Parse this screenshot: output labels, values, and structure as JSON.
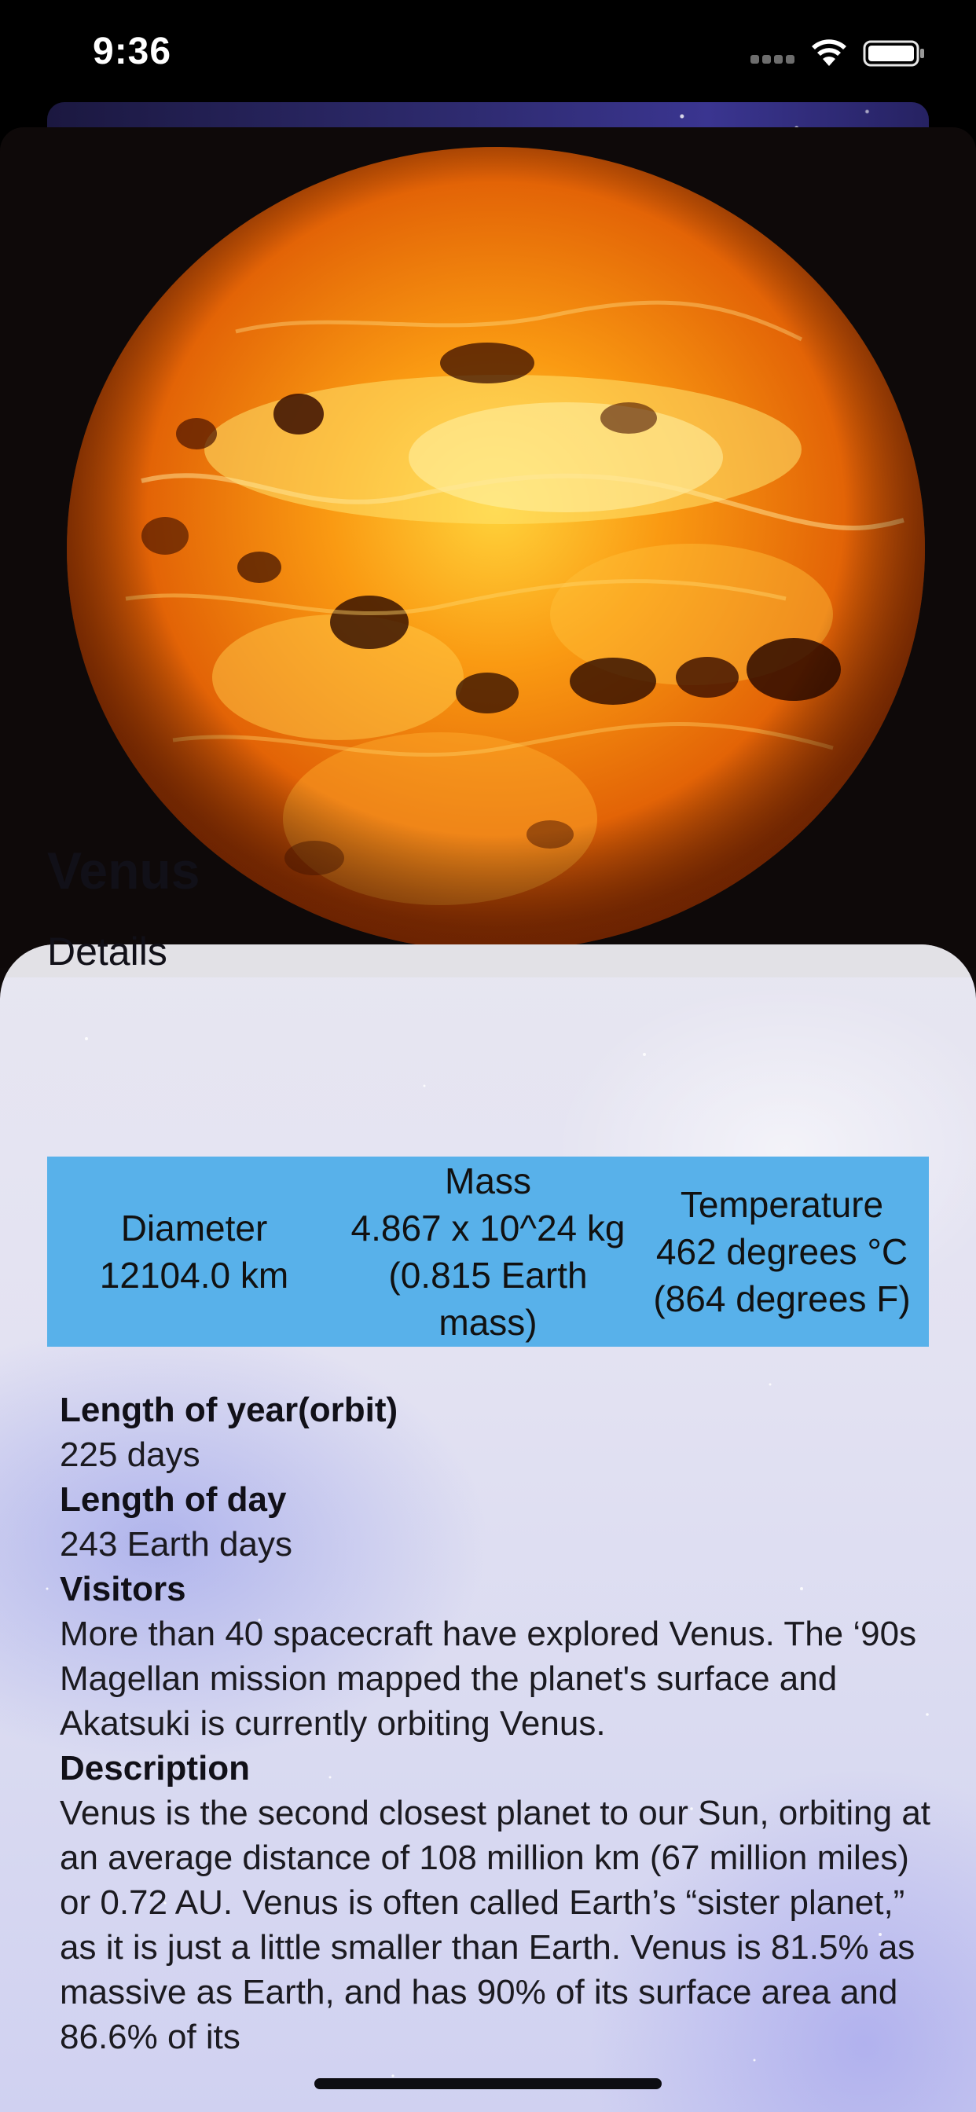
{
  "status_bar": {
    "time": "9:36"
  },
  "planet": {
    "name": "Venus",
    "details_heading": "Details"
  },
  "stats": [
    {
      "label": "Diameter",
      "value": "12104.0 km"
    },
    {
      "label": "Mass",
      "value": "4.867 x 10^24 kg (0.815 Earth mass)"
    },
    {
      "label": "Temperature",
      "value": "462 degrees °C (864 degrees F)"
    }
  ],
  "facts": [
    {
      "label": "Length of year(orbit)",
      "value": "225 days"
    },
    {
      "label": "Length of day",
      "value": "243 Earth days"
    },
    {
      "label": "Visitors",
      "value": "More than 40 spacecraft have explored Venus. The ‘90s Magellan mission mapped the planet's surface and Akatsuki is currently orbiting Venus."
    },
    {
      "label": "Description",
      "value": "Venus is the second closest planet to our Sun, orbiting at an average distance of 108 million km (67 million miles) or 0.72 AU. Venus is often called Earth’s “sister planet,” as it is just a little smaller than Earth. Venus is 81.5% as massive as Earth, and has 90% of its surface area and 86.6% of its"
    }
  ]
}
